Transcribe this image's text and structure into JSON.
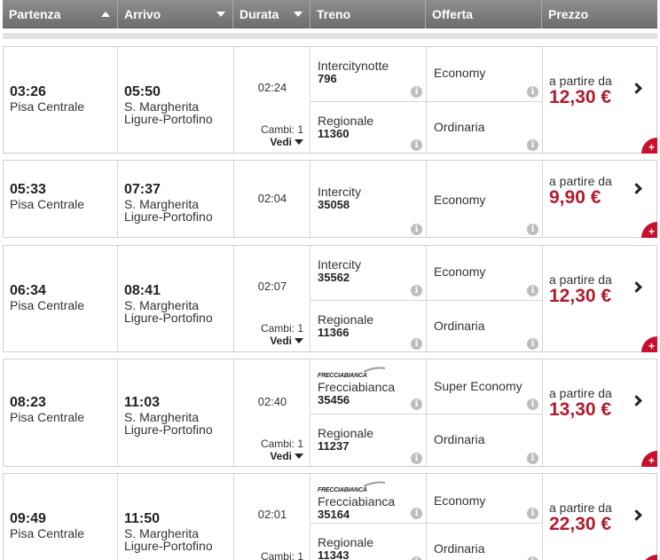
{
  "header": {
    "partenza": "Partenza",
    "arrivo": "Arrivo",
    "durata": "Durata",
    "treno": "Treno",
    "offerta": "Offerta",
    "prezzo": "Prezzo"
  },
  "labels": {
    "from": "a partire da",
    "vedi": "Vedi",
    "info_glyph": "i",
    "plus_glyph": "+",
    "frecciabianca_logo": "FRECCIABIANCA"
  },
  "rows": [
    {
      "dep_time": "03:26",
      "dep_station": "Pisa Centrale",
      "arr_time": "05:50",
      "arr_station": "S. Margherita Ligure-Portofino",
      "duration": "02:24",
      "changes": "Cambi: 1",
      "trains": [
        {
          "name": "Intercitynotte",
          "number": "796",
          "offer": "Economy"
        },
        {
          "name": "Regionale",
          "number": "11360",
          "offer": "Ordinaria"
        }
      ],
      "price": "12,30 €"
    },
    {
      "dep_time": "05:33",
      "dep_station": "Pisa Centrale",
      "arr_time": "07:37",
      "arr_station": "S. Margherita Ligure-Portofino",
      "duration": "02:04",
      "trains": [
        {
          "name": "Intercity",
          "number": "35058",
          "offer": "Economy"
        }
      ],
      "price": "9,90 €"
    },
    {
      "dep_time": "06:34",
      "dep_station": "Pisa Centrale",
      "arr_time": "08:41",
      "arr_station": "S. Margherita Ligure-Portofino",
      "duration": "02:07",
      "changes": "Cambi: 1",
      "trains": [
        {
          "name": "Intercity",
          "number": "35562",
          "offer": "Economy"
        },
        {
          "name": "Regionale",
          "number": "11366",
          "offer": "Ordinaria"
        }
      ],
      "price": "12,30 €"
    },
    {
      "dep_time": "08:23",
      "dep_station": "Pisa Centrale",
      "arr_time": "11:03",
      "arr_station": "S. Margherita Ligure-Portofino",
      "duration": "02:40",
      "changes": "Cambi: 1",
      "trains": [
        {
          "name": "Frecciabianca",
          "number": "35456",
          "offer": "Super Economy",
          "logo": true
        },
        {
          "name": "Regionale",
          "number": "11237",
          "offer": "Ordinaria"
        }
      ],
      "price": "13,30 €"
    },
    {
      "dep_time": "09:49",
      "dep_station": "Pisa Centrale",
      "arr_time": "11:50",
      "arr_station": "S. Margherita Ligure-Portofino",
      "duration": "02:01",
      "changes": "Cambi: 1",
      "trains": [
        {
          "name": "Frecciabianca",
          "number": "35164",
          "offer": "Economy",
          "logo": true
        },
        {
          "name": "Regionale",
          "number": "11343",
          "offer": "Ordinaria"
        }
      ],
      "price": "22,30 €"
    }
  ],
  "colors": {
    "price": "#b01c2e",
    "header_bg": "#7f7f7f",
    "plus_badge": "#c8102e"
  }
}
